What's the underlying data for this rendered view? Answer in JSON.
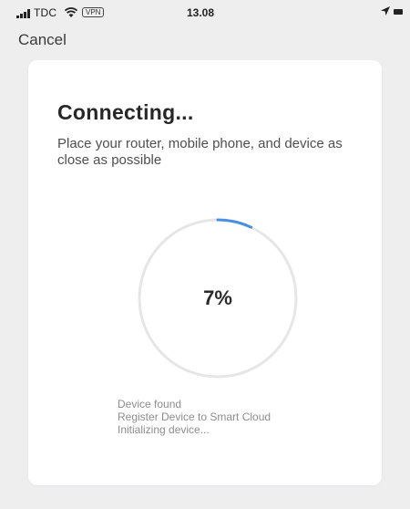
{
  "status_bar": {
    "carrier": "TDC",
    "vpn_badge": "VPN",
    "time": "13.08",
    "icons": [
      "signal-bars-icon",
      "wifi-icon",
      "location-arrow-icon",
      "battery-icon"
    ]
  },
  "nav": {
    "cancel_label": "Cancel"
  },
  "card": {
    "title": "Connecting...",
    "instruction": "Place your router, mobile phone, and device as close as possible",
    "progress": {
      "percent_label": "7%",
      "fraction": 0.07,
      "accent_color": "#4a90e2",
      "track_color": "#e6e6e6"
    },
    "steps": [
      "Device found",
      "Register Device to Smart Cloud",
      "Initializing device..."
    ]
  }
}
